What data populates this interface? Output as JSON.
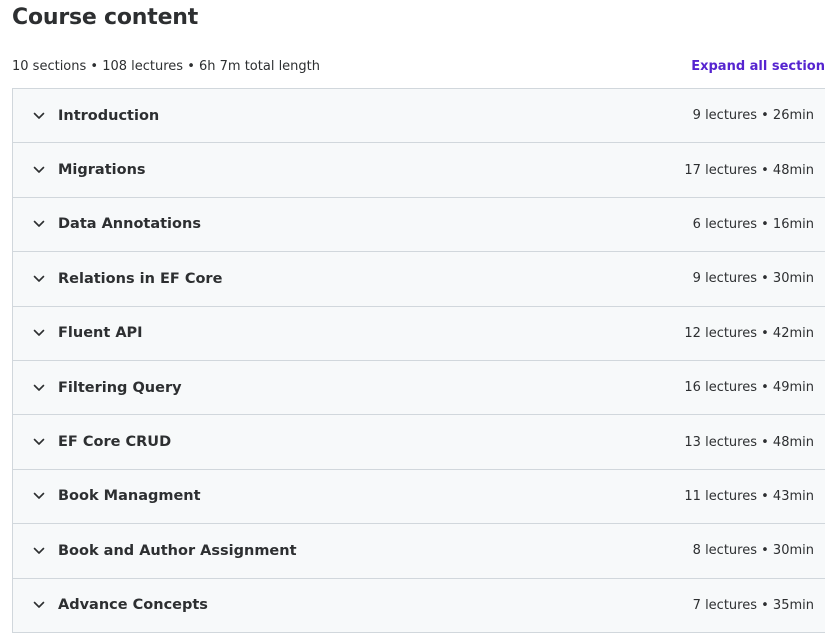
{
  "header": {
    "title": "Course content",
    "summary": "10 sections • 108 lectures • 6h 7m total length",
    "expand_label": "Expand all section"
  },
  "icons": {
    "section_toggle": "chevron-down-icon"
  },
  "colors": {
    "accent": "#5624d0",
    "row_bg": "#f7f9fa",
    "border": "#d1d7dc",
    "text": "#2d2f31"
  },
  "sections": [
    {
      "title": "Introduction",
      "meta": "9 lectures • 26min"
    },
    {
      "title": "Migrations",
      "meta": "17 lectures • 48min"
    },
    {
      "title": "Data Annotations",
      "meta": "6 lectures • 16min"
    },
    {
      "title": "Relations in EF Core",
      "meta": "9 lectures • 30min"
    },
    {
      "title": "Fluent API",
      "meta": "12 lectures • 42min"
    },
    {
      "title": "Filtering Query",
      "meta": "16 lectures • 49min"
    },
    {
      "title": "EF Core CRUD",
      "meta": "13 lectures • 48min"
    },
    {
      "title": "Book Managment",
      "meta": "11 lectures • 43min"
    },
    {
      "title": "Book and Author Assignment",
      "meta": "8 lectures • 30min"
    },
    {
      "title": "Advance Concepts",
      "meta": "7 lectures • 35min"
    }
  ]
}
